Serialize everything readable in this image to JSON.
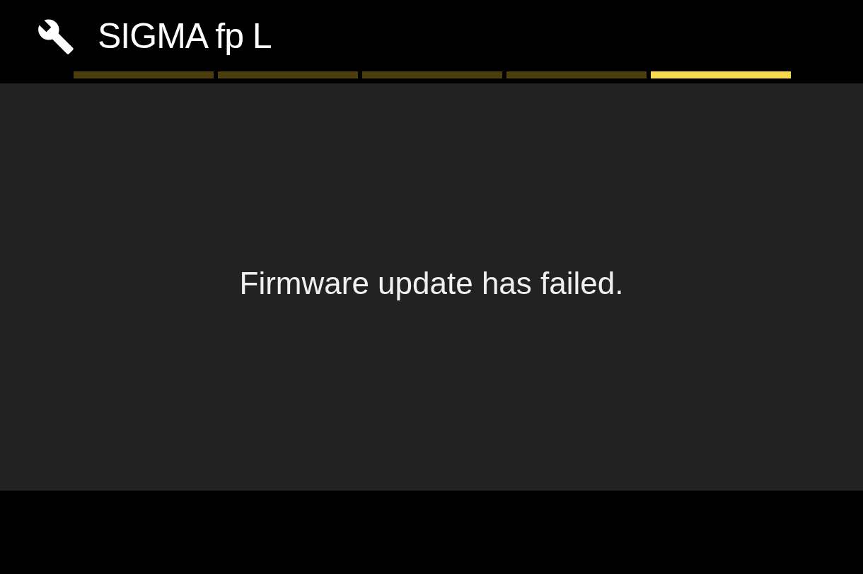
{
  "header": {
    "title": "SIGMA fp L"
  },
  "pages": [
    {
      "selected": false
    },
    {
      "selected": false
    },
    {
      "selected": false
    },
    {
      "selected": false
    },
    {
      "selected": true
    }
  ],
  "message": "Firmware update has failed."
}
